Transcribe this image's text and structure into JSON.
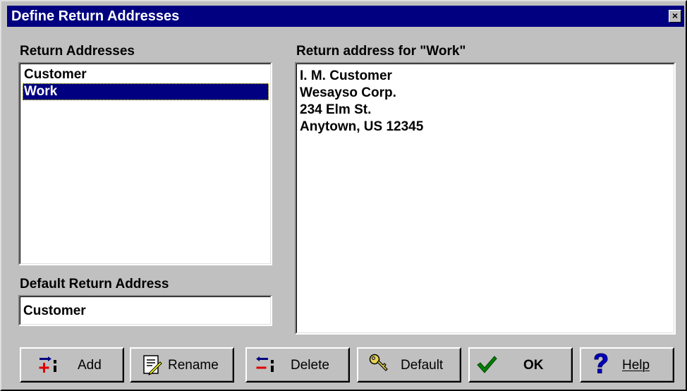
{
  "window": {
    "title": "Define Return Addresses",
    "close_glyph": "×"
  },
  "return_addresses": {
    "label": "Return Addresses",
    "items": [
      {
        "label": "Customer",
        "selected": false
      },
      {
        "label": "Work",
        "selected": true
      }
    ]
  },
  "default_return_address": {
    "label": "Default Return Address",
    "value": "Customer"
  },
  "address_panel": {
    "label": "Return address for \"Work\"",
    "lines": [
      "I. M. Customer",
      "Wesayso Corp.",
      "234 Elm St.",
      "Anytown, US 12345"
    ]
  },
  "buttons": {
    "add": {
      "label": "Add",
      "icon": "add-icon"
    },
    "rename": {
      "label": "Rename",
      "icon": "rename-icon"
    },
    "delete": {
      "label": "Delete",
      "icon": "delete-icon"
    },
    "default": {
      "label": "Default",
      "icon": "key-icon"
    },
    "ok": {
      "label": "OK",
      "icon": "checkmark-icon"
    },
    "help": {
      "label": "Help",
      "icon": "question-mark-icon"
    }
  },
  "colors": {
    "title_bar": "#000080",
    "face": "#c0c0c0",
    "selection": "#000080"
  }
}
